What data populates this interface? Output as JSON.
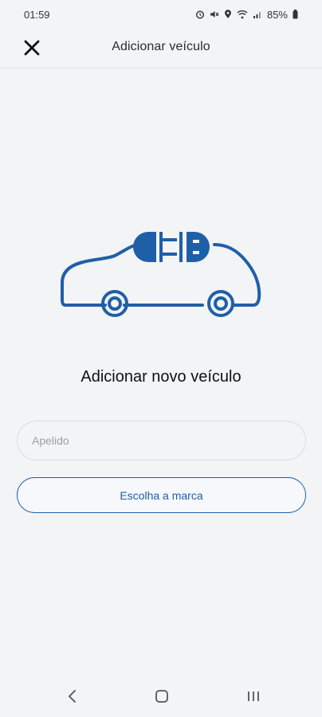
{
  "status_bar": {
    "time": "01:59",
    "battery": "85%",
    "icons": [
      "alarm-icon",
      "mute-icon",
      "location-icon",
      "wifi-icon",
      "signal-icon",
      "battery-icon"
    ]
  },
  "app_bar": {
    "title": "Adicionar veículo",
    "close_icon": "close-icon"
  },
  "content": {
    "illustration": "electric-car-plug-icon",
    "heading": "Adicionar novo veículo",
    "nickname_placeholder": "Apelido",
    "nickname_value": "",
    "brand_button_label": "Escolha a marca"
  },
  "nav_bar": {
    "icons": [
      "back-icon",
      "home-icon",
      "recents-icon"
    ]
  },
  "colors": {
    "accent": "#1f5fa8",
    "background": "#f3f4f6"
  }
}
